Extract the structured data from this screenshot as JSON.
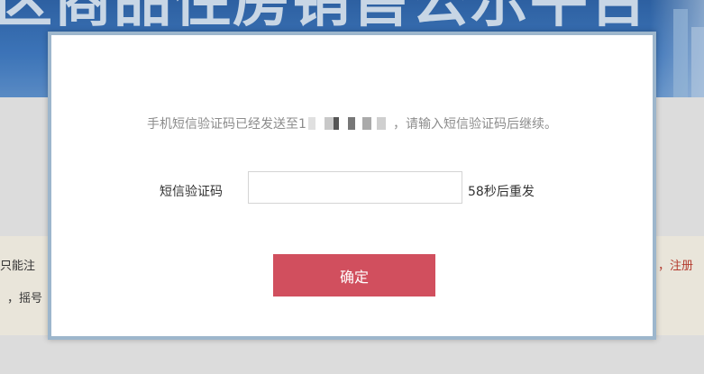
{
  "background": {
    "banner_title": "区商品住房销售公示平台",
    "left_line1": "只能注",
    "left_line2": "，摇号",
    "right_line1": "，注册"
  },
  "dialog": {
    "notice_prefix": "手机短信验证码已经发送至1",
    "notice_suffix": "，请输入短信验证码后继续。",
    "sms_label": "短信验证码",
    "sms_value": "",
    "countdown": "58秒后重发",
    "confirm_label": "确定"
  },
  "colors": {
    "banner": "#3a78c4",
    "confirm_button": "#d14f5e",
    "dialog_border": "#9db6cc"
  }
}
